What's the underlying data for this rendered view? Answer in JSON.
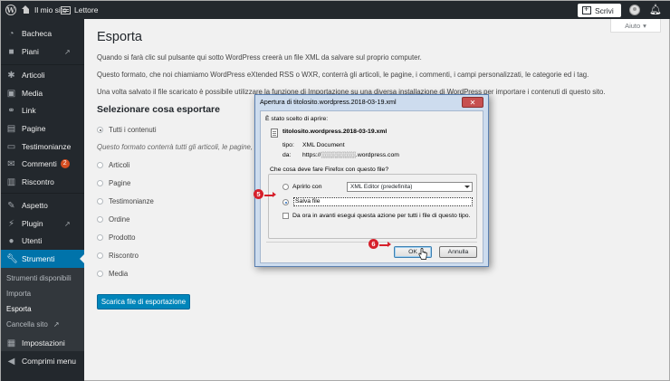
{
  "adminbar": {
    "site_name": "Il mio sito",
    "reader": "Lettore",
    "write_button": "Scrivi"
  },
  "help": {
    "label": "Aiuto"
  },
  "sidebar": {
    "items": [
      {
        "label": "Bacheca",
        "icon": "dashboard-icon"
      },
      {
        "label": "Piani",
        "icon": "plans-icon"
      },
      {
        "label": "Articoli",
        "icon": "pin-icon"
      },
      {
        "label": "Media",
        "icon": "media-icon"
      },
      {
        "label": "Link",
        "icon": "link-icon"
      },
      {
        "label": "Pagine",
        "icon": "pages-icon"
      },
      {
        "label": "Testimonianze",
        "icon": "testimonial-icon"
      },
      {
        "label": "Commenti",
        "icon": "comments-icon",
        "badge": "2"
      },
      {
        "label": "Riscontro",
        "icon": "feedback-icon"
      },
      {
        "label": "Aspetto",
        "icon": "appearance-icon"
      },
      {
        "label": "Plugin",
        "icon": "plugin-icon"
      },
      {
        "label": "Utenti",
        "icon": "users-icon"
      },
      {
        "label": "Strumenti",
        "icon": "tools-icon"
      },
      {
        "label": "Impostazioni",
        "icon": "settings-icon"
      },
      {
        "label": "Comprimi menu",
        "icon": "collapse-icon"
      }
    ],
    "submenu": [
      {
        "label": "Strumenti disponibili"
      },
      {
        "label": "Importa"
      },
      {
        "label": "Esporta"
      },
      {
        "label": "Cancella sito"
      }
    ]
  },
  "main": {
    "title": "Esporta",
    "paragraphs": [
      "Quando si farà clic sul pulsante qui sotto WordPress creerà un file XML da salvare sul proprio computer.",
      "Questo formato, che noi chiamiamo WordPress eXtended RSS o WXR, conterrà gli articoli, le pagine, i commenti, i campi personalizzati, le categorie ed i tag.",
      "Una volta salvato il file scaricato è possibile utilizzare la funzione di Importazione su una diversa installazione di WordPress per importare i contenuti di questo sito."
    ],
    "section_title": "Selezionare cosa esportare",
    "options": [
      "Tutti i contenuti",
      "Articoli",
      "Pagine",
      "Testimonianze",
      "Ordine",
      "Prodotto",
      "Riscontro",
      "Media"
    ],
    "selected_option": "Tutti i contenuti",
    "description": "Questo formato conterrà tutti gli articoli, le pagine, i c",
    "export_button": "Scarica file di esportazione"
  },
  "dialog": {
    "title": "Apertura di titolosito.wordpress.2018-03-19.xml",
    "chosen_label": "È stato scelto di aprire:",
    "filename": "titolosito.wordpress.2018-03-19.xml",
    "type_label": "tipo:",
    "type_value": "XML Document",
    "from_label": "da:",
    "from_value": "https://░░░░░░░░.wordpress.com",
    "question": "Che cosa deve fare Firefox con questo file?",
    "open_with_label": "Aprirlo con",
    "open_with_app": "XML Editor (predefinita)",
    "save_label": "Salva file",
    "always_label": "Da ora in avanti esegui questa azione per tutti i file di questo tipo.",
    "ok": "OK",
    "cancel": "Annulla",
    "step5": "5",
    "step6": "6"
  }
}
